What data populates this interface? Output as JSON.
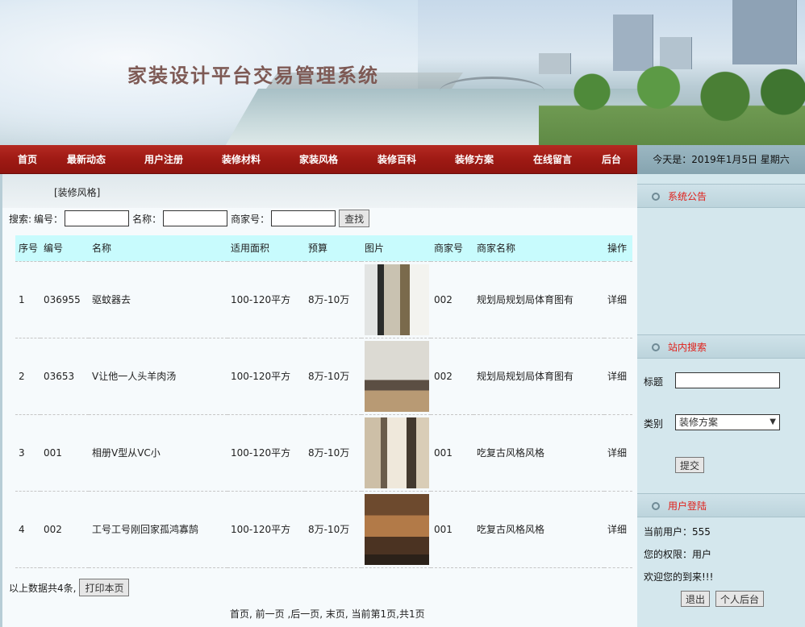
{
  "banner": {
    "title": "家装设计平台交易管理系统"
  },
  "nav": {
    "items": [
      "首页",
      "最新动态",
      "用户注册",
      "装修材料",
      "家装风格",
      "装修百科",
      "装修方案",
      "在线留言",
      "后台"
    ],
    "date": "今天是：2019年1月5日 星期六"
  },
  "breadcrumb": "[装修风格]",
  "search": {
    "label": "搜索:",
    "field1": "编号：",
    "field2": "名称：",
    "field3": "商家号：",
    "button": "查找"
  },
  "table": {
    "headers": [
      "序号",
      "编号",
      "名称",
      "适用面积",
      "预算",
      "图片",
      "商家号",
      "商家名称",
      "操作"
    ],
    "rows": [
      {
        "idx": "1",
        "code": "036955",
        "name": "驱蚊器去",
        "area": "100-120平方",
        "budget": "8万-10万",
        "merchant_no": "002",
        "merchant_name": "规划局规划局体育图有",
        "action": "详细"
      },
      {
        "idx": "2",
        "code": "03653",
        "name": "V让他一人头羊肉汤",
        "area": "100-120平方",
        "budget": "8万-10万",
        "merchant_no": "002",
        "merchant_name": "规划局规划局体育图有",
        "action": "详细"
      },
      {
        "idx": "3",
        "code": "001",
        "name": "相册V型从VC小",
        "area": "100-120平方",
        "budget": "8万-10万",
        "merchant_no": "001",
        "merchant_name": "吃复古风格风格",
        "action": "详细"
      },
      {
        "idx": "4",
        "code": "002",
        "name": "工号工号刚回家孤鸿寡鹄",
        "area": "100-120平方",
        "budget": "8万-10万",
        "merchant_no": "001",
        "merchant_name": "吃复古风格风格",
        "action": "详细"
      }
    ]
  },
  "summary": {
    "text": "以上数据共4条,",
    "print_button": "打印本页"
  },
  "pager": "首页, 前一页 ,后一页, 末页, 当前第1页,共1页",
  "side": {
    "notice_title": "系统公告",
    "search_title": "站内搜索",
    "search_label_title": "标题",
    "search_label_type": "类别",
    "search_type_value": "装修方案",
    "search_submit": "提交",
    "login_title": "用户登陆",
    "current_user": "当前用户：555",
    "permission": "您的权限：用户",
    "welcome": "欢迎您的到来!!!",
    "logout_button": "退出",
    "backend_button": "个人后台"
  }
}
